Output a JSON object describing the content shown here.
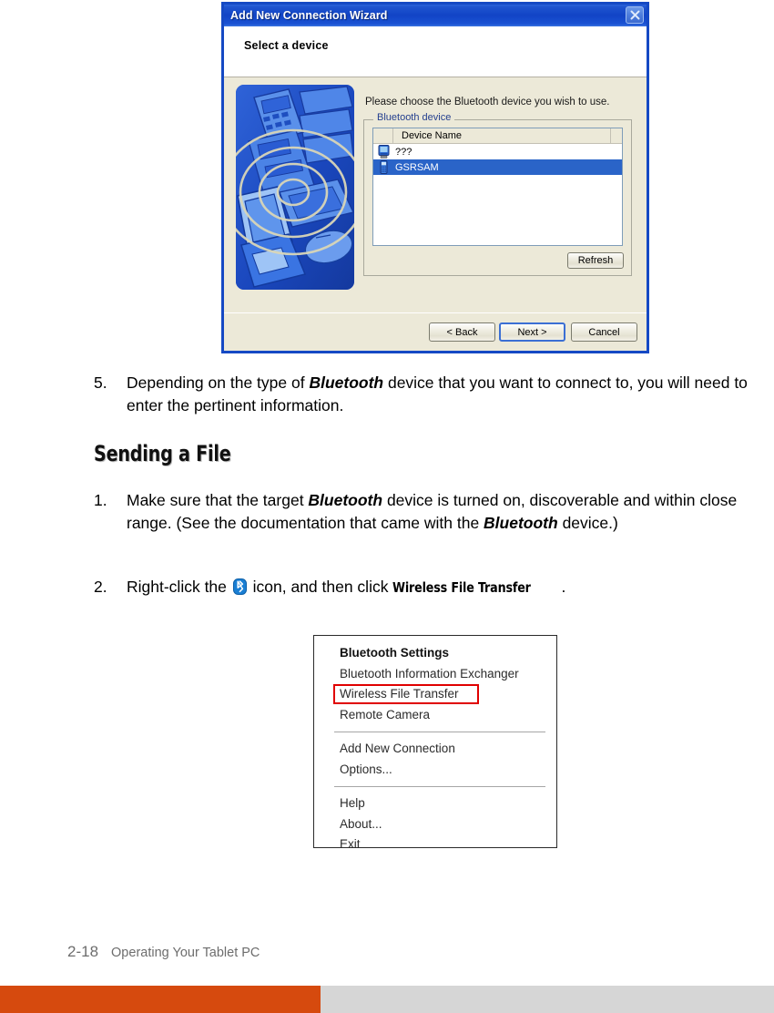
{
  "wizard": {
    "title": "Add New Connection Wizard",
    "close_icon": "close-icon",
    "header_title": "Select a device",
    "prompt": "Please choose the Bluetooth device you wish to use.",
    "group_legend": "Bluetooth device",
    "column_header": "Device Name",
    "devices": [
      {
        "name": "???",
        "icon": "pda-device-icon",
        "selected": false
      },
      {
        "name": "GSRSAM",
        "icon": "mobile-phone-icon",
        "selected": true
      }
    ],
    "refresh_label": "Refresh",
    "buttons": {
      "back": "< Back",
      "next": "Next >",
      "cancel": "Cancel"
    },
    "colors": {
      "titlebar": "#1144c6",
      "selection": "#2a64c8",
      "face": "#ece9d8",
      "legend_text": "#25408f"
    }
  },
  "document": {
    "step5": {
      "number": "5.",
      "part1": "Depending on the type of ",
      "italic1": "Bluetooth",
      "part2": " device that you want to connect to, you will need to enter the pertinent information."
    },
    "heading": "Sending a File",
    "sending_step1": {
      "number": "1.",
      "part1": "Make sure that the target ",
      "italic1": "Bluetooth",
      "part2": " device is turned on, discoverable and within close range. (See the documentation that came with the ",
      "italic2": "Bluetooth",
      "part3": " device.)"
    },
    "sending_step2": {
      "number": "2.",
      "part1": "Right-click the ",
      "icon": "bluetooth-icon",
      "part2": " icon, and then click ",
      "bold_term": "Wireless File Transfer",
      "part3": "."
    }
  },
  "context_menu": {
    "items": [
      {
        "label": "Bluetooth Settings",
        "bold": true,
        "highlighted": false
      },
      {
        "label": "Bluetooth Information Exchanger",
        "bold": false,
        "highlighted": false
      },
      {
        "label": "Wireless File Transfer",
        "bold": false,
        "highlighted": true
      },
      {
        "label": "Remote Camera",
        "bold": false,
        "highlighted": false
      },
      {
        "separator": true
      },
      {
        "label": "Add New Connection",
        "bold": false,
        "highlighted": false
      },
      {
        "label": "Options...",
        "bold": false,
        "highlighted": false
      },
      {
        "separator": true
      },
      {
        "label": "Help",
        "bold": false,
        "highlighted": false
      },
      {
        "label": "About...",
        "bold": false,
        "highlighted": false
      },
      {
        "label": "Exit",
        "bold": false,
        "highlighted": false
      }
    ],
    "highlight_color": "#e00000"
  },
  "footer": {
    "page_number": "2-18",
    "page_label": "Operating Your Tablet PC",
    "bar_orange": "#d64a0e",
    "bar_gray": "#d6d6d6"
  }
}
